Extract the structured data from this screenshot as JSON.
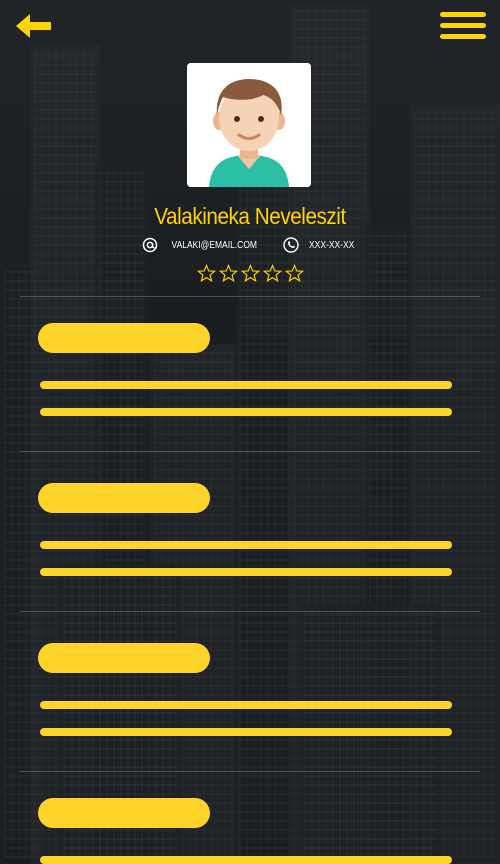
{
  "profile": {
    "name": "Valakineka Neveleszit",
    "email": "VALAKI@EMAIL.COM",
    "phone": "XXX-XX-XX",
    "rating": 0,
    "rating_max": 5
  },
  "icons": {
    "back": "arrow-left-icon",
    "menu": "hamburger-menu-icon",
    "email": "at-sign-icon",
    "phone": "phone-icon",
    "star": "star-outline-icon"
  },
  "colors": {
    "accent": "#ffd42a",
    "text": "#ffffff"
  }
}
